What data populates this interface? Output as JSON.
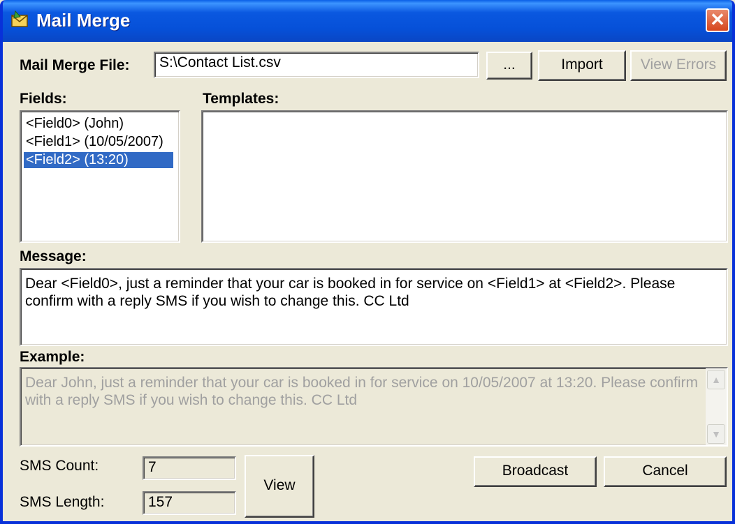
{
  "window": {
    "title": "Mail Merge",
    "close_glyph": "✕"
  },
  "file": {
    "label": "Mail Merge File:",
    "value": "S:\\Contact List.csv",
    "browse_label": "...",
    "import_label": "Import",
    "view_errors_label": "View Errors"
  },
  "fields": {
    "label": "Fields:",
    "items": [
      "<Field0> (John)",
      "<Field1> (10/05/2007)",
      "<Field2> (13:20)"
    ],
    "selected_index": 2
  },
  "templates": {
    "label": "Templates:"
  },
  "message": {
    "label": "Message:",
    "text": "Dear <Field0>, just a reminder that your car is booked in for service on <Field1> at <Field2>.  Please confirm with a reply SMS if you wish to change this. CC Ltd"
  },
  "example": {
    "label": "Example:",
    "text": "Dear John, just a reminder that your car is booked in for service on 10/05/2007 at 13:20.  Please confirm with a reply SMS if you wish to change this. CC Ltd"
  },
  "sms": {
    "count_label": "SMS Count:",
    "count_value": "7",
    "length_label": "SMS Length:",
    "length_value": "157",
    "view_label": "View"
  },
  "actions": {
    "broadcast_label": "Broadcast",
    "cancel_label": "Cancel"
  },
  "icons": {
    "app": "mail-merge-icon",
    "close": "close-icon",
    "scroll_up": "scroll-up-icon",
    "scroll_down": "scroll-down-icon"
  },
  "colors": {
    "titlebar": "#0a58e0",
    "selection": "#316ac5",
    "face": "#ece9d8",
    "close": "#d6461e"
  }
}
